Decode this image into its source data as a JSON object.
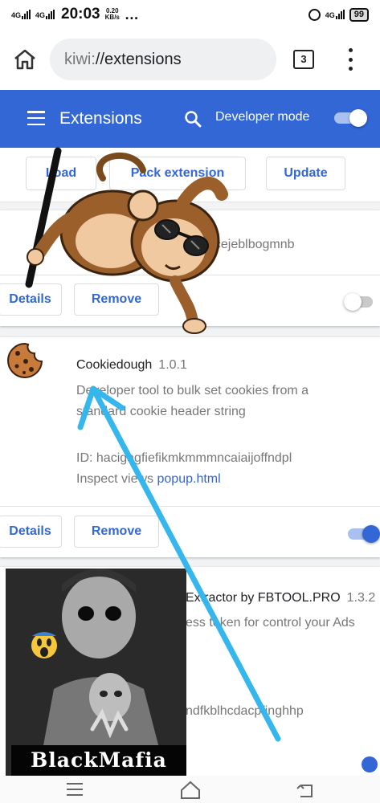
{
  "status_bar": {
    "network_1": "4G",
    "network_2": "4G",
    "time": "20:03",
    "speed_value": "0.20",
    "speed_unit": "KB/s",
    "overflow": "…",
    "network_3": "4G",
    "battery": "99"
  },
  "browser": {
    "url_scheme": "kiwi:",
    "url_path": "//extensions",
    "tab_count": "3"
  },
  "header": {
    "title": "Extensions",
    "developer_mode_label": "Developer mode",
    "developer_mode_on": true
  },
  "dev_buttons": {
    "load": "Load",
    "pack": "Pack extension",
    "update": "Update"
  },
  "extensions": [
    {
      "id_partial": "acejeblbogmnb",
      "details_label": "Details",
      "remove_label": "Remove",
      "enabled": false
    },
    {
      "name": "Cookiedough",
      "version": "1.0.1",
      "description_line1": "Developer tool to bulk set cookies from a",
      "description_line2": "standard cookie header string",
      "id_label": "ID: hacigagfiefikmkmmmncaiaijoffndpl",
      "inspect_label": "Inspect views",
      "inspect_link": "popup.html",
      "details_label": "Details",
      "remove_label": "Remove",
      "enabled": true
    },
    {
      "name_partial": "Extractor by FBTOOL.PRO",
      "version": "1.3.2",
      "description_partial": "ess token for control your Ads",
      "id_partial": "ndfkblhcdacpfjnghhp"
    }
  ],
  "overlay": {
    "photo_caption": "BlackMafia"
  },
  "colors": {
    "accent": "#3367d6",
    "header_bg": "#3367d6",
    "arrow": "#35b6ec",
    "page_bg": "#f1f3f4"
  },
  "icons": [
    "home-icon",
    "tabs-icon",
    "more-vert-icon",
    "menu-icon",
    "search-icon",
    "cookie-icon",
    "alarm-icon",
    "battery-icon"
  ]
}
